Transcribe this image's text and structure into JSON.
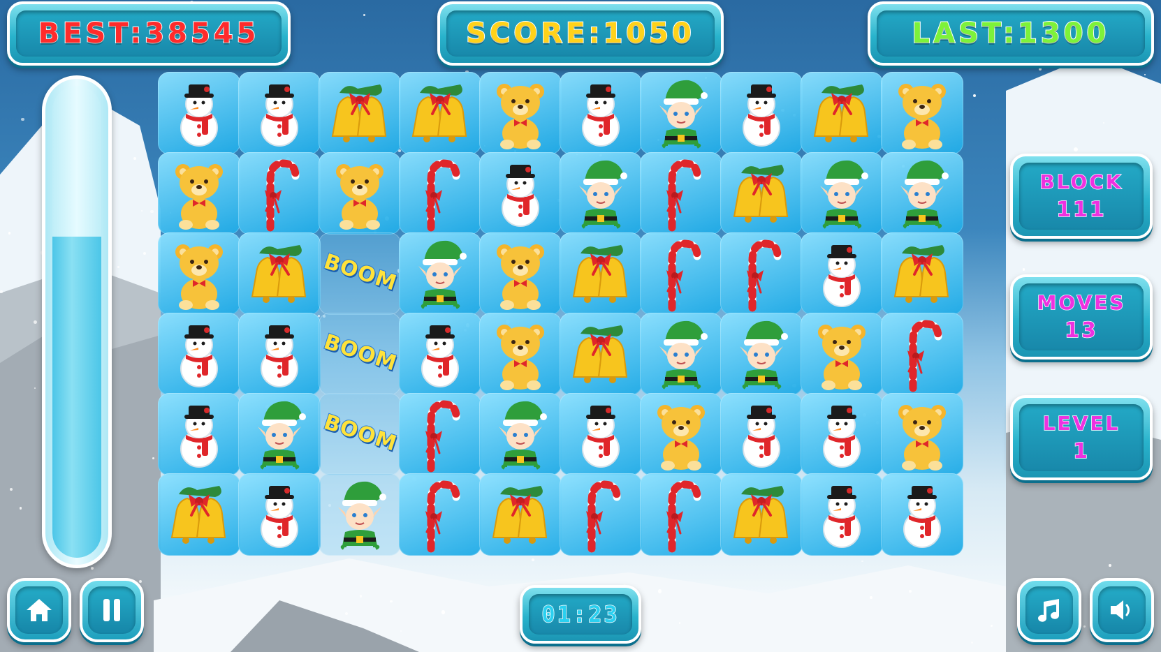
{
  "hud": {
    "best_label": "BEST:38545",
    "score_label": "SCORE:1050",
    "last_label": "LAST:1300",
    "best_color": "#ff2b2b",
    "score_color": "#ffd21a",
    "last_color": "#7df23a"
  },
  "side": {
    "block_label": "BLOCK",
    "block_value": "111",
    "moves_label": "MOVES",
    "moves_value": "13",
    "level_label": "LEVEL",
    "level_value": "1"
  },
  "progress": {
    "fill_fraction": 0.68
  },
  "timer": "01:23",
  "boom_text": "BOOM",
  "buttons": {
    "home": "home-icon",
    "pause": "pause-icon",
    "music": "music-note-icon",
    "sound": "speaker-icon"
  },
  "board": {
    "rows": 6,
    "cols": 10,
    "grid": [
      [
        "snowman",
        "snowman",
        "bells",
        "bells",
        "bear",
        "snowman",
        "elf",
        "snowman",
        "bells",
        "bear"
      ],
      [
        "bear",
        "cane",
        "bear",
        "cane",
        "snowman",
        "elf",
        "cane",
        "bells",
        "elf",
        "elf"
      ],
      [
        "bear",
        "bells",
        "boom",
        "elf",
        "bear",
        "bells",
        "cane",
        "cane",
        "snowman",
        "bells"
      ],
      [
        "snowman",
        "snowman",
        "boom",
        "snowman",
        "bear",
        "bells",
        "elf",
        "elf",
        "bear",
        "cane"
      ],
      [
        "snowman",
        "elf",
        "boom",
        "cane",
        "elf",
        "snowman",
        "bear",
        "snowman",
        "snowman",
        "bear"
      ],
      [
        "bells",
        "snowman",
        "elf",
        "cane",
        "bells",
        "cane",
        "cane",
        "bells",
        "snowman",
        "snowman"
      ]
    ],
    "cleared": [
      [
        2,
        2
      ],
      [
        3,
        2
      ],
      [
        4,
        2
      ],
      [
        5,
        2
      ]
    ]
  }
}
